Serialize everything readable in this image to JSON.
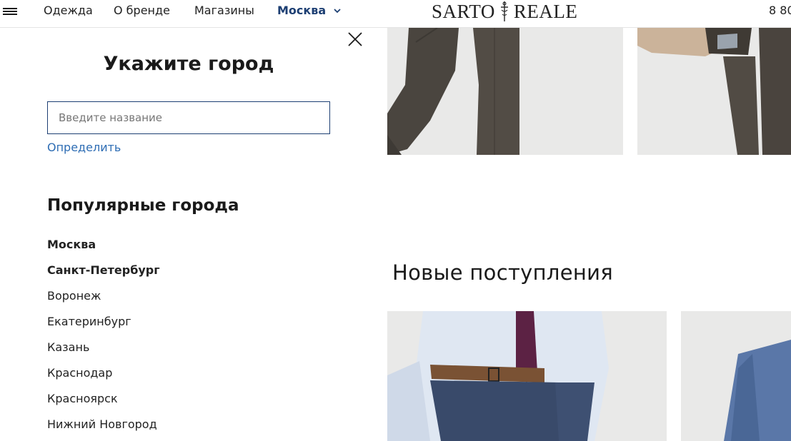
{
  "header": {
    "menu_icon": "hamburger-menu-icon",
    "nav": [
      {
        "label": "Одежда"
      },
      {
        "label": "О бренде"
      },
      {
        "label": "Магазины"
      }
    ],
    "city": {
      "label": "Москва",
      "icon": "chevron-down-icon",
      "color": "#1d3f73"
    },
    "logo": {
      "left": "SARTO",
      "right": "REALE",
      "emblem_icon": "sword-emblem-icon"
    },
    "phone": "8 80"
  },
  "city_panel": {
    "title": "Укажите город",
    "close_icon": "close-icon",
    "search": {
      "placeholder": "Введите название",
      "value": ""
    },
    "detect_link": "Определить",
    "popular_title": "Популярные города",
    "cities": [
      {
        "name": "Москва",
        "bold": true
      },
      {
        "name": "Санкт-Петербург",
        "bold": true
      },
      {
        "name": "Воронеж",
        "bold": false
      },
      {
        "name": "Екатеринбург",
        "bold": false
      },
      {
        "name": "Казань",
        "bold": false
      },
      {
        "name": "Краснодар",
        "bold": false
      },
      {
        "name": "Красноярск",
        "bold": false
      },
      {
        "name": "Нижний Новгород",
        "bold": false
      }
    ],
    "accent_color": "#2e6db4"
  },
  "content": {
    "section_title": "Новые поступления"
  }
}
